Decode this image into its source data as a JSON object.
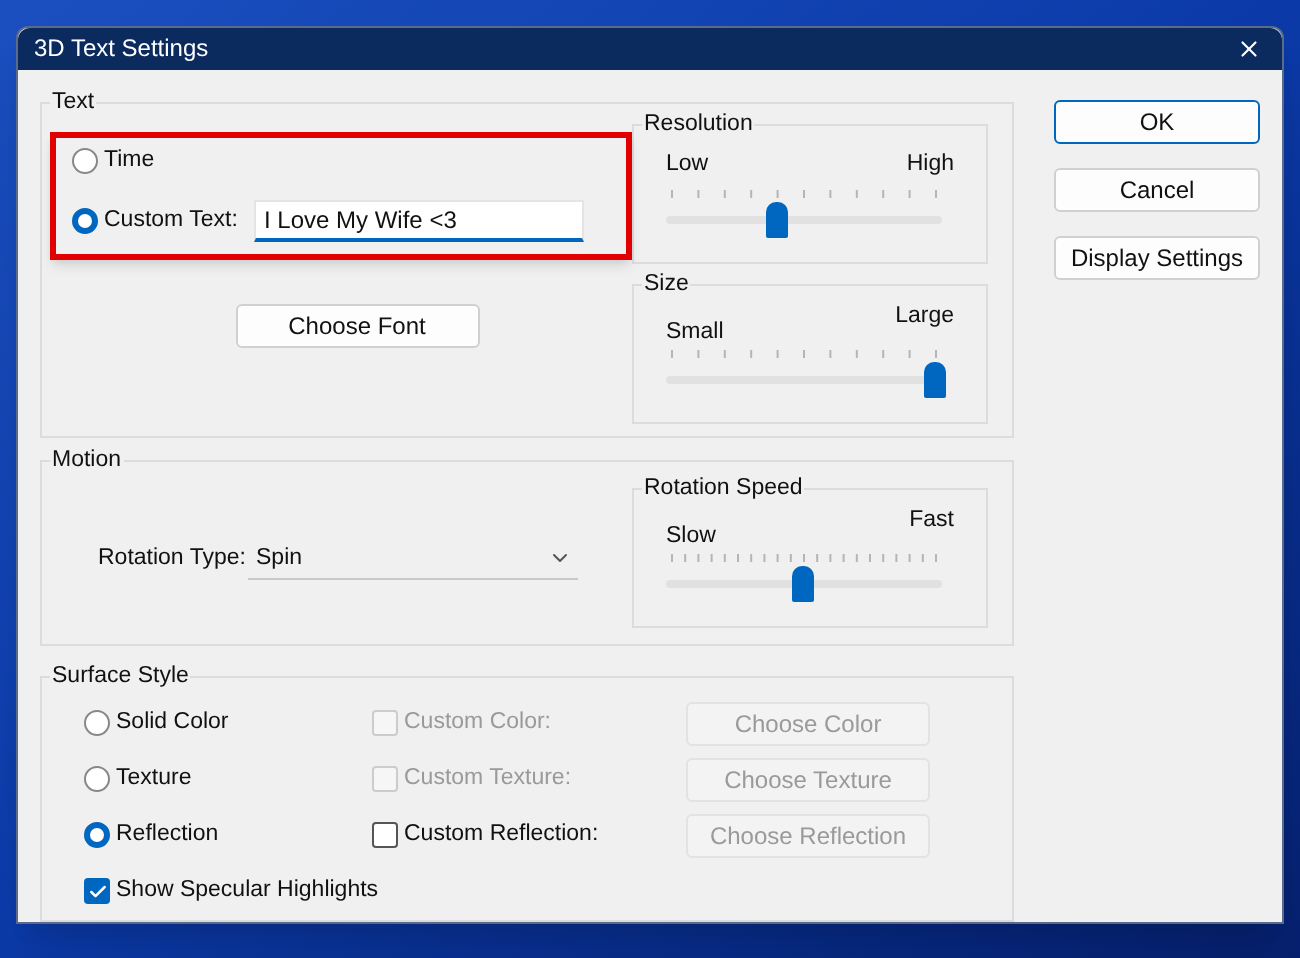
{
  "window": {
    "title": "3D Text Settings"
  },
  "text_group": {
    "label": "Text",
    "options": [
      {
        "label": "Time",
        "selected": false
      },
      {
        "label": "Custom Text:",
        "selected": true
      }
    ],
    "custom_text": {
      "value": "I Love My Wife <3"
    },
    "choose_font": "Choose Font"
  },
  "resolution": {
    "label": "Resolution",
    "min_label": "Low",
    "max_label": "High",
    "level": 0.4
  },
  "size": {
    "label": "Size",
    "min_label": "Small",
    "max_label": "Large",
    "level": 1
  },
  "motion": {
    "label": "Motion",
    "rotation_type_label": "Rotation Type:",
    "rotation_type": "Spin",
    "rotation_speed": {
      "label": "Rotation Speed",
      "min_label": "Slow",
      "max_label": "Fast",
      "level": 0.5
    }
  },
  "surface_style": {
    "label": "Surface Style",
    "rows": [
      {
        "option": {
          "label": "Solid Color",
          "selected": false
        },
        "custom": {
          "label": "Custom Color:",
          "checked": false,
          "disabled": true
        },
        "button": {
          "label": "Choose Color",
          "disabled": true
        }
      },
      {
        "option": {
          "label": "Texture",
          "selected": false
        },
        "custom": {
          "label": "Custom Texture:",
          "checked": false,
          "disabled": true
        },
        "button": {
          "label": "Choose Texture",
          "disabled": true
        }
      },
      {
        "option": {
          "label": "Reflection",
          "selected": true
        },
        "custom": {
          "label": "Custom Reflection:",
          "checked": false,
          "disabled": false
        },
        "button": {
          "label": "Choose Reflection",
          "disabled": true
        }
      }
    ],
    "specular": {
      "label": "Show Specular Highlights",
      "checked": true
    }
  },
  "buttons": [
    {
      "label": "OK",
      "default": true
    },
    {
      "label": "Cancel",
      "default": false
    },
    {
      "label": "Display Settings",
      "default": false
    }
  ]
}
